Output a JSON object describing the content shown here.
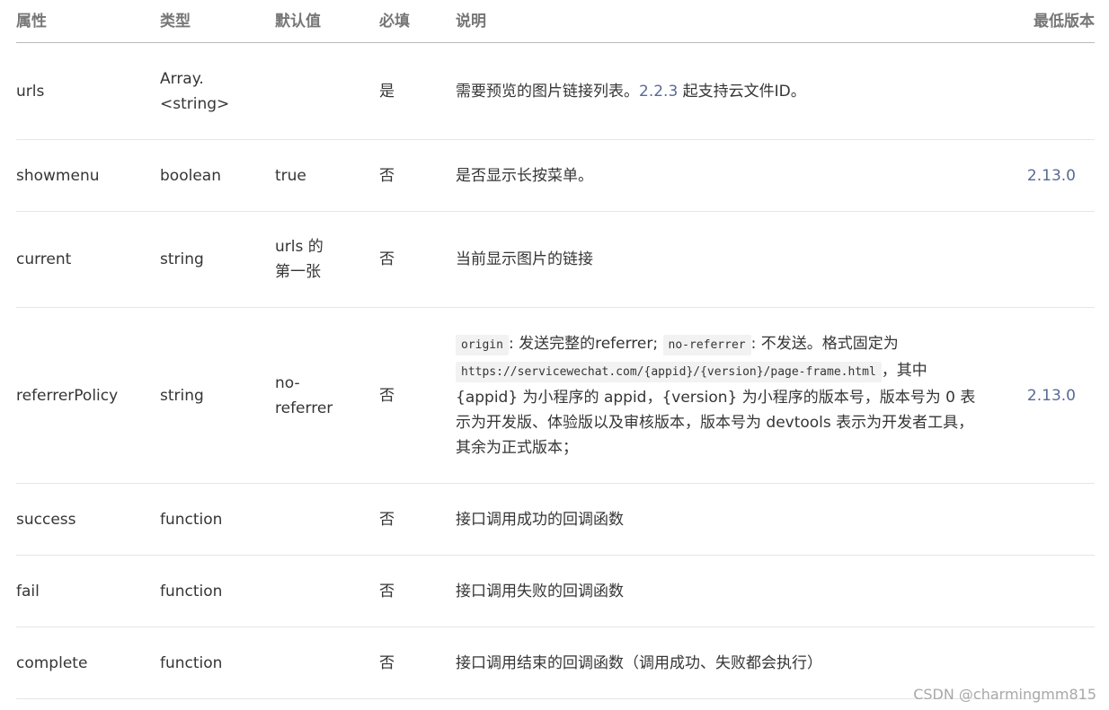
{
  "headers": {
    "attr": "属性",
    "type": "类型",
    "default": "默认值",
    "required": "必填",
    "desc": "说明",
    "min_version": "最低版本"
  },
  "rows": [
    {
      "attr": "urls",
      "type_line1": "Array.",
      "type_line2": "<string>",
      "default": "",
      "required": "是",
      "desc_prefix": "需要预览的图片链接列表。",
      "desc_version": "2.2.3",
      "desc_suffix": " 起支持云文件ID。",
      "min_version": ""
    },
    {
      "attr": "showmenu",
      "type": "boolean",
      "default": "true",
      "required": "否",
      "desc": "是否显示长按菜单。",
      "min_version": "2.13.0"
    },
    {
      "attr": "current",
      "type": "string",
      "default_line1": "urls 的",
      "default_line2": "第一张",
      "required": "否",
      "desc": "当前显示图片的链接",
      "min_version": ""
    },
    {
      "attr": "referrerPolicy",
      "type": "string",
      "default_line1": "no-",
      "default_line2": "referrer",
      "required": "否",
      "desc_code1": "origin",
      "desc_text1": ": 发送完整的referrer; ",
      "desc_code2": "no-referrer",
      "desc_text2": ": 不发送。格式固定为 ",
      "desc_code3": "https://servicewechat.com/{appid}/{version}/page-frame.html",
      "desc_text3": "，其中 {appid} 为小程序的 appid，{version} 为小程序的版本号，版本号为 0 表示为开发版、体验版以及审核版本，版本号为 devtools 表示为开发者工具，其余为正式版本；",
      "min_version": "2.13.0"
    },
    {
      "attr": "success",
      "type": "function",
      "default": "",
      "required": "否",
      "desc": "接口调用成功的回调函数",
      "min_version": ""
    },
    {
      "attr": "fail",
      "type": "function",
      "default": "",
      "required": "否",
      "desc": "接口调用失败的回调函数",
      "min_version": ""
    },
    {
      "attr": "complete",
      "type": "function",
      "default": "",
      "required": "否",
      "desc": "接口调用结束的回调函数（调用成功、失败都会执行）",
      "min_version": ""
    }
  ],
  "watermark": "CSDN @charmingmm815",
  "colors": {
    "text": "#353535",
    "header_text": "#767676",
    "link": "#576b95",
    "code_bg": "#f2f2f2",
    "row_border": "#e6e6e6"
  }
}
